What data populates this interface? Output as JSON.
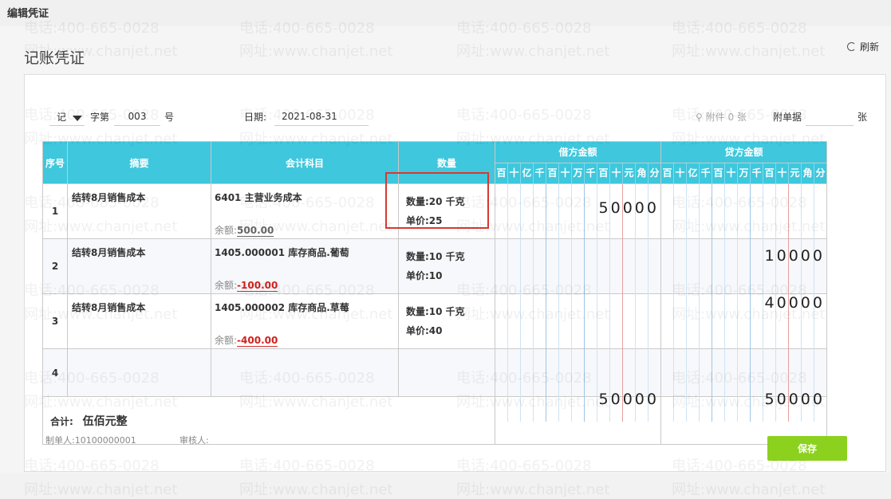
{
  "window_title": "编辑凭证",
  "page_title": "记账凭证",
  "refresh_label": "刷新",
  "header": {
    "voucher_type": "记",
    "word_label": "字第",
    "number": "003",
    "number_suffix": "号",
    "date_label": "日期:",
    "date_value": "2021-08-31",
    "attach_label": "附件 0 张",
    "attach_docs_label": "附单据",
    "sheets_suffix": "张"
  },
  "columns": {
    "index": "序号",
    "summary": "摘要",
    "account": "会计科目",
    "qty": "数量",
    "debit": "借方金额",
    "credit": "贷方金额",
    "digits": [
      "百",
      "十",
      "亿",
      "千",
      "百",
      "十",
      "万",
      "千",
      "百",
      "十",
      "元",
      "角",
      "分"
    ]
  },
  "rows": [
    {
      "idx": "1",
      "summary": "结转8月销售成本",
      "account": "6401 主营业务成本",
      "balance_label": "余额:",
      "balance": "500.00",
      "qty_line": "数量:20 千克",
      "price_line": "单价:25",
      "debit": "50000",
      "credit": ""
    },
    {
      "idx": "2",
      "summary": "结转8月销售成本",
      "account": "1405.000001 库存商品.葡萄",
      "balance_label": "余额:",
      "balance": "-100.00",
      "qty_line": "数量:10 千克",
      "price_line": "单价:10",
      "debit": "",
      "credit": "10000"
    },
    {
      "idx": "3",
      "summary": "结转8月销售成本",
      "account": "1405.000002 库存商品.草莓",
      "balance_label": "余额:",
      "balance": "-400.00",
      "qty_line": "数量:10 千克",
      "price_line": "单价:40",
      "debit": "",
      "credit": "40000"
    },
    {
      "idx": "4",
      "summary": "",
      "account": "",
      "balance_label": "",
      "balance": "",
      "qty_line": "",
      "price_line": "",
      "debit": "",
      "credit": ""
    }
  ],
  "total": {
    "label": "合计:",
    "words": "伍佰元整",
    "debit": "50000",
    "credit": "50000"
  },
  "footer": {
    "preparer": "制单人:10100000001",
    "reviewer": "审核人:"
  },
  "save_label": "保存",
  "watermark": {
    "phone": "电话:400-665-0028",
    "site": "网址:www.chanjet.net"
  }
}
